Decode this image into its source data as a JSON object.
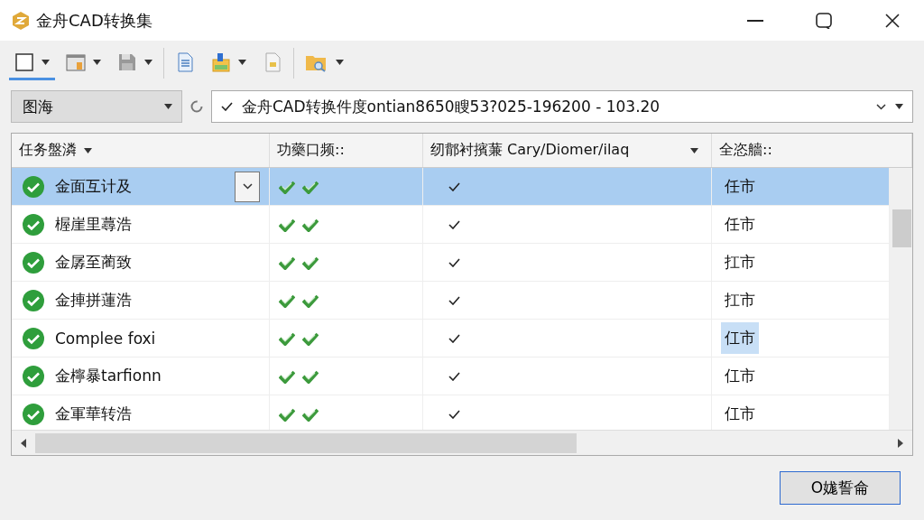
{
  "window": {
    "title": "金舟CAD转换集"
  },
  "toolbar": [
    {
      "kind": "blank",
      "dropdown": true,
      "selected": true
    },
    {
      "kind": "window",
      "dropdown": true,
      "selected": false
    },
    {
      "kind": "save",
      "dropdown": true,
      "selected": false
    },
    {
      "kind": "document",
      "dropdown": false,
      "selected": false
    },
    {
      "kind": "export",
      "dropdown": true,
      "selected": false
    },
    {
      "kind": "image",
      "dropdown": false,
      "selected": false
    },
    {
      "kind": "folder",
      "dropdown": true,
      "selected": false
    }
  ],
  "location": {
    "combo": "图海",
    "path": "金舟CAD转换件度ontian8650瞍53?025-196200 - 103.20"
  },
  "table": {
    "columns": [
      {
        "label": "任务盤潾",
        "sort": true
      },
      {
        "label": "功藥口频::",
        "sort": false
      },
      {
        "label": "纫鄁衬擯蒹 Cary/Diomer/ilaq",
        "sort": true
      },
      {
        "label": "全恣艢::",
        "sort": false
      }
    ],
    "rows": [
      {
        "name": "金面互计及",
        "selected": true,
        "editing": true,
        "status": "任市",
        "highlighted": false
      },
      {
        "name": "楃崖里蕁浩",
        "selected": false,
        "editing": false,
        "status": "任市",
        "highlighted": false
      },
      {
        "name": "金孱至蔺致",
        "selected": false,
        "editing": false,
        "status": "扛市",
        "highlighted": false
      },
      {
        "name": "金捙拼蓮浩",
        "selected": false,
        "editing": false,
        "status": "扛市",
        "highlighted": false
      },
      {
        "name": "Complee foxi",
        "selected": false,
        "editing": false,
        "status": "仜市",
        "highlighted": true
      },
      {
        "name": "金檸暴tarfionn",
        "selected": false,
        "editing": false,
        "status": "仜市",
        "highlighted": false
      },
      {
        "name": "金軍華转浩",
        "selected": false,
        "editing": false,
        "status": "仜市",
        "highlighted": false
      }
    ]
  },
  "buttons": [
    {
      "label": "O娏誓侖"
    }
  ]
}
